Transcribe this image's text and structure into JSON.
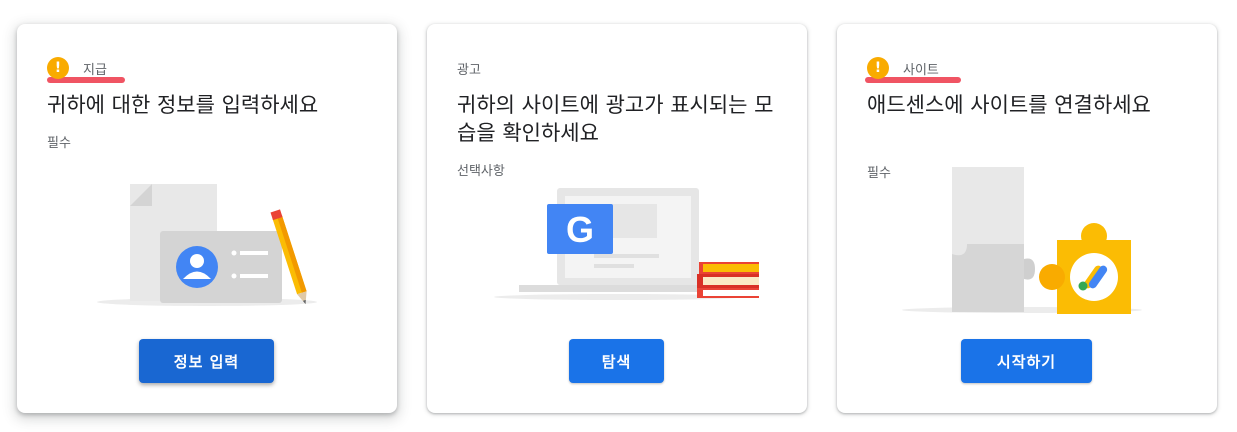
{
  "cards": [
    {
      "label": "지급",
      "title": "귀하에 대한 정보를 입력하세요",
      "sub": "필수",
      "button": "정보 입력"
    },
    {
      "label": "광고",
      "title": "귀하의 사이트에 광고가 표시되는 모습을 확인하세요",
      "sub": "선택사항",
      "button": "탐색",
      "google_letter": "G"
    },
    {
      "label": "사이트",
      "title": "애드센스에 사이트를 연결하세요",
      "sub": "필수",
      "button": "시작하기"
    }
  ],
  "icons": {
    "warning": "!",
    "warning_color": "#f9ab00"
  },
  "colors": {
    "primary_button": "#1a73e8",
    "highlight_mark": "#ef4b5b"
  }
}
